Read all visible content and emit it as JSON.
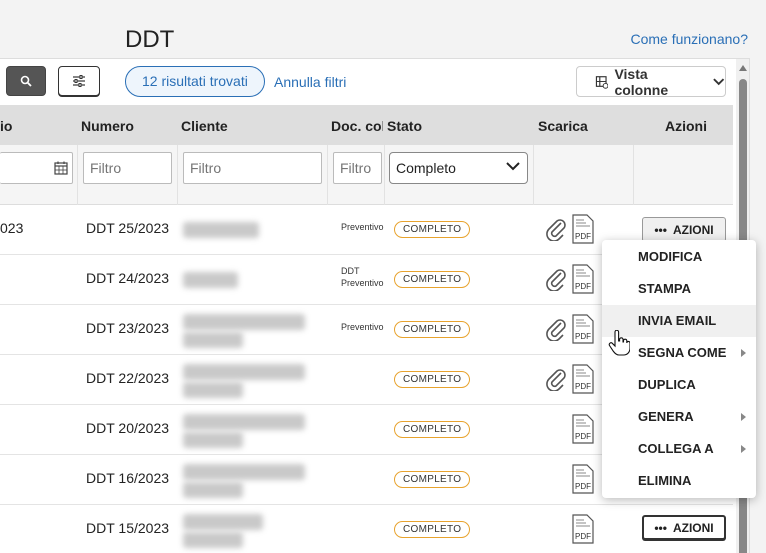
{
  "header": {
    "title": "DDT",
    "help_link": "Come funzionano?"
  },
  "toolbar": {
    "results": "12 risultati trovati",
    "clear_filters": "Annulla filtri",
    "columns_button": "Vista colonne"
  },
  "table": {
    "columns": [
      "io",
      "Numero",
      "Cliente",
      "Doc. coll",
      "Stato",
      "Scarica",
      "Azioni"
    ],
    "filters": {
      "numero_placeholder": "Filtro",
      "cliente_placeholder": "Filtro",
      "doc_placeholder": "Filtro",
      "stato_value": "Completo"
    },
    "rows": [
      {
        "date": "023",
        "numero": "DDT 25/2023",
        "doc": [
          "Preventivo"
        ],
        "stato": "COMPLETO",
        "attachment": true,
        "azioni": "AZIONI"
      },
      {
        "date": "",
        "numero": "DDT 24/2023",
        "doc": [
          "DDT",
          "Preventivo"
        ],
        "stato": "COMPLETO",
        "attachment": true
      },
      {
        "date": "",
        "numero": "DDT 23/2023",
        "doc": [
          "Preventivo"
        ],
        "stato": "COMPLETO",
        "attachment": true
      },
      {
        "date": "",
        "numero": "DDT 22/2023",
        "doc": [],
        "stato": "COMPLETO",
        "attachment": true
      },
      {
        "date": "",
        "numero": "DDT 20/2023",
        "doc": [],
        "stato": "COMPLETO",
        "attachment": false
      },
      {
        "date": "",
        "numero": "DDT 16/2023",
        "doc": [],
        "stato": "COMPLETO",
        "attachment": false
      },
      {
        "date": "",
        "numero": "DDT 15/2023",
        "doc": [],
        "stato": "COMPLETO",
        "attachment": false,
        "azioni": "AZIONI"
      }
    ]
  },
  "actions_menu": {
    "items": [
      {
        "label": "MODIFICA",
        "submenu": false
      },
      {
        "label": "STAMPA",
        "submenu": false
      },
      {
        "label": "INVIA EMAIL",
        "submenu": false,
        "hover": true
      },
      {
        "label": "SEGNA COME",
        "submenu": true
      },
      {
        "label": "DUPLICA",
        "submenu": false
      },
      {
        "label": "GENERA",
        "submenu": true
      },
      {
        "label": "COLLEGA A",
        "submenu": true
      },
      {
        "label": "ELIMINA",
        "submenu": false
      }
    ]
  },
  "colors": {
    "accent": "#2a6fb6",
    "badge_border": "#e8a32e",
    "header_bg": "#dedede"
  },
  "icons": [
    "search-icon",
    "sliders-icon",
    "columns-icon",
    "chevron-down-icon",
    "calendar-icon",
    "paperclip-icon",
    "pdf-icon",
    "ellipsis-icon",
    "hand-cursor-icon"
  ]
}
